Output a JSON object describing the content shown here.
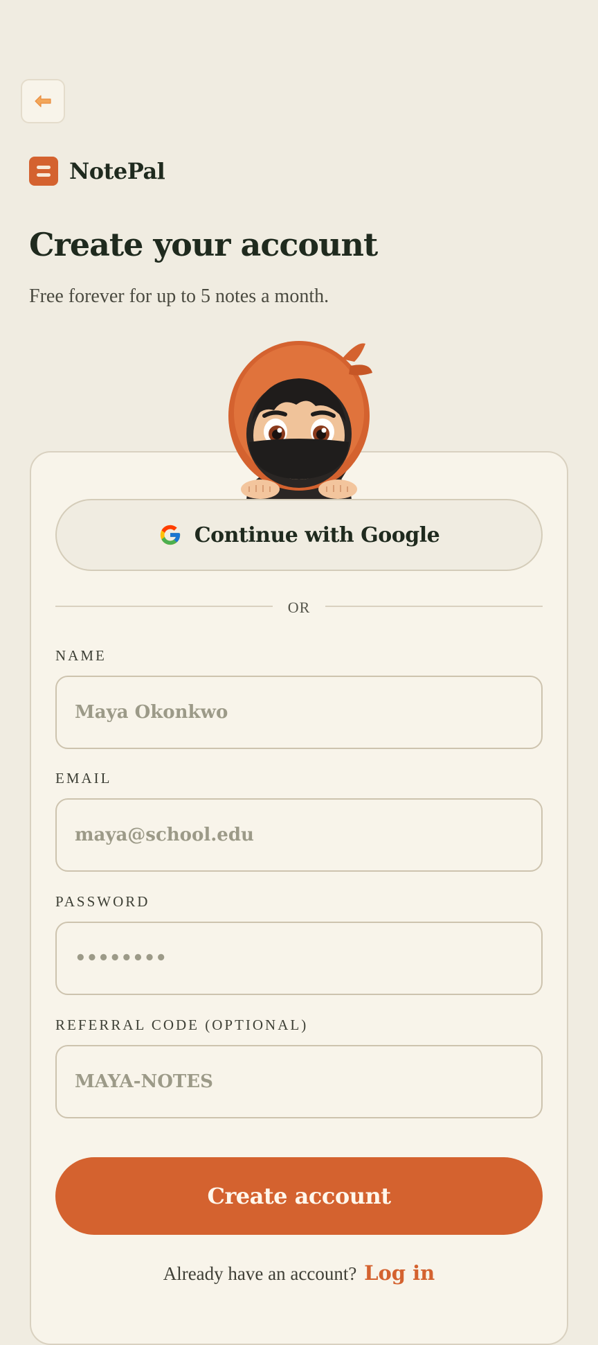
{
  "brand": {
    "name": "NotePal",
    "color": "#d4622f"
  },
  "header": {
    "back_icon": "arrow-left-icon",
    "title": "Create your account",
    "subtitle": "Free forever for up to 5 notes a month."
  },
  "mascot": {
    "description_icon": "ninja-mascot-icon"
  },
  "auth": {
    "google_label": "Continue with Google",
    "google_icon": "google-logo-icon",
    "divider_text": "OR"
  },
  "form": {
    "name": {
      "label": "NAME",
      "value": "Maya Okonkwo"
    },
    "email": {
      "label": "EMAIL",
      "value": "maya@school.edu"
    },
    "password": {
      "label": "PASSWORD",
      "value": "••••••••"
    },
    "referral": {
      "label": "REFERRAL CODE (OPTIONAL)",
      "value": "MAYA-NOTES"
    },
    "submit_label": "Create account"
  },
  "footer": {
    "prompt": "Already have an account?",
    "login_label": "Log in"
  },
  "colors": {
    "background": "#f0ece1",
    "card": "#f8f4ea",
    "accent": "#d4622f",
    "text": "#1f2a1e"
  }
}
